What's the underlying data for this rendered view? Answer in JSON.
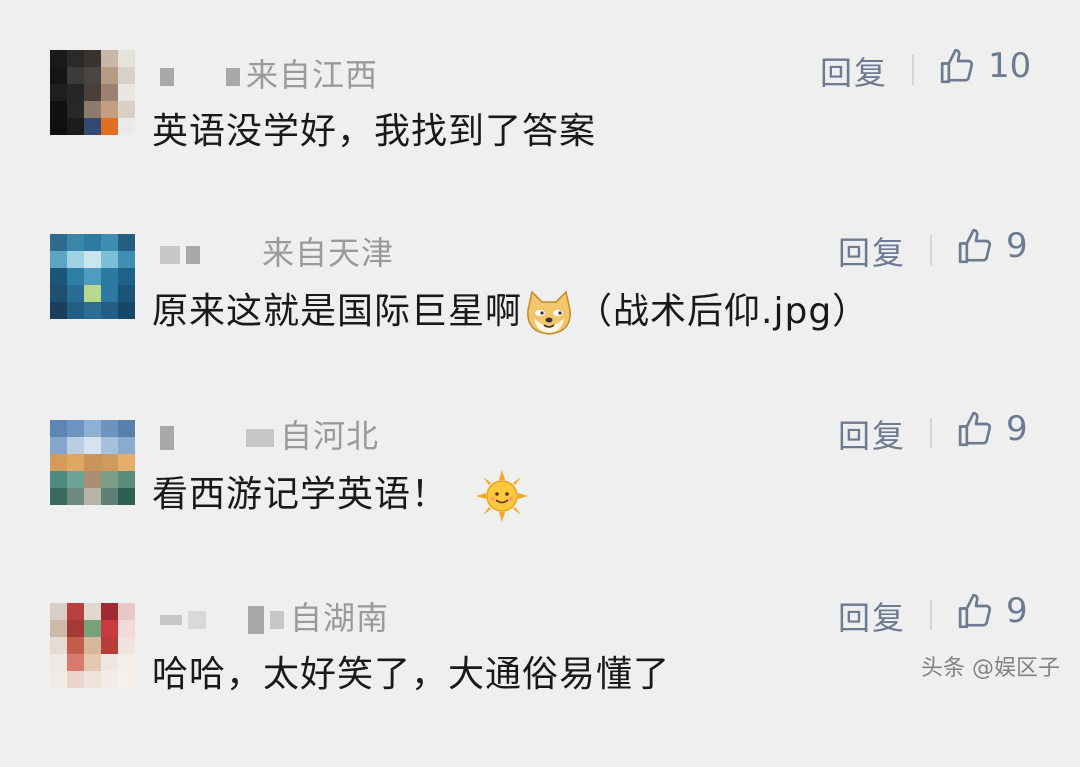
{
  "comments": [
    {
      "location": "来自江西",
      "text": "英语没学好，我找到了答案",
      "reply_label": "回复",
      "likes": "10"
    },
    {
      "location": "来自天津",
      "text": "原来这就是国际巨星啊",
      "text_suffix": "（战术后仰.jpg）",
      "emoji": "doge-emoji",
      "reply_label": "回复",
      "likes": "9"
    },
    {
      "location": "自河北",
      "text": "看西游记学英语！",
      "emoji": "sun-emoji",
      "reply_label": "回复",
      "likes": "9"
    },
    {
      "location": "自湖南",
      "text": "哈哈，太好笑了，大通俗易懂了",
      "reply_label": "回复",
      "likes": "9"
    }
  ],
  "watermark": "头条 @娱区子"
}
